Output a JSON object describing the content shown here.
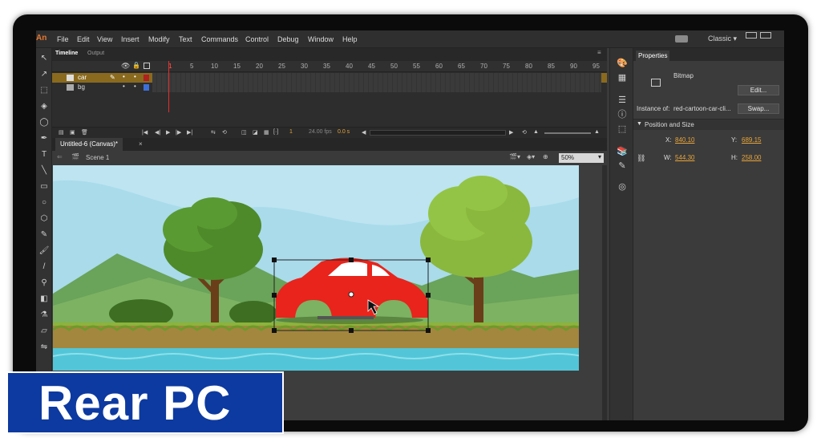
{
  "menu": [
    "File",
    "Edit",
    "View",
    "Insert",
    "Modify",
    "Text",
    "Commands",
    "Control",
    "Debug",
    "Window",
    "Help"
  ],
  "workspace": "Classic",
  "timeline": {
    "tabs": [
      "Timeline",
      "Output"
    ],
    "frame_numbers": [
      "1",
      "5",
      "10",
      "15",
      "20",
      "25",
      "30",
      "35",
      "40",
      "45",
      "50",
      "55",
      "60",
      "65",
      "70",
      "75",
      "80",
      "85",
      "90",
      "95"
    ],
    "layers": [
      {
        "name": "car",
        "selected": true
      },
      {
        "name": "bg",
        "selected": false
      }
    ],
    "current_frame": "1",
    "fps": "24.00 fps",
    "time": "0.0 s"
  },
  "document": {
    "tab": "Untitled-6 (Canvas)*",
    "scene": "Scene 1",
    "zoom": "50%"
  },
  "properties": {
    "tab": "Properties",
    "type": "Bitmap",
    "edit_label": "Edit...",
    "instance_label": "Instance of:",
    "instance_name": "red-cartoon-car-cli...",
    "swap_label": "Swap...",
    "section": "Position and Size",
    "x_label": "X:",
    "x": "840.10",
    "y_label": "Y:",
    "y": "689.15",
    "w_label": "W:",
    "w": "544.30",
    "h_label": "H:",
    "h": "258.00"
  },
  "watermark": "Rear PC",
  "colors": {
    "accent": "#e8a53a",
    "car": "#e8241c",
    "sky": "#a9dbeb",
    "water": "#52c6d8",
    "grass": "#8cb43c",
    "watermark_bg": "#0d3aa0"
  }
}
